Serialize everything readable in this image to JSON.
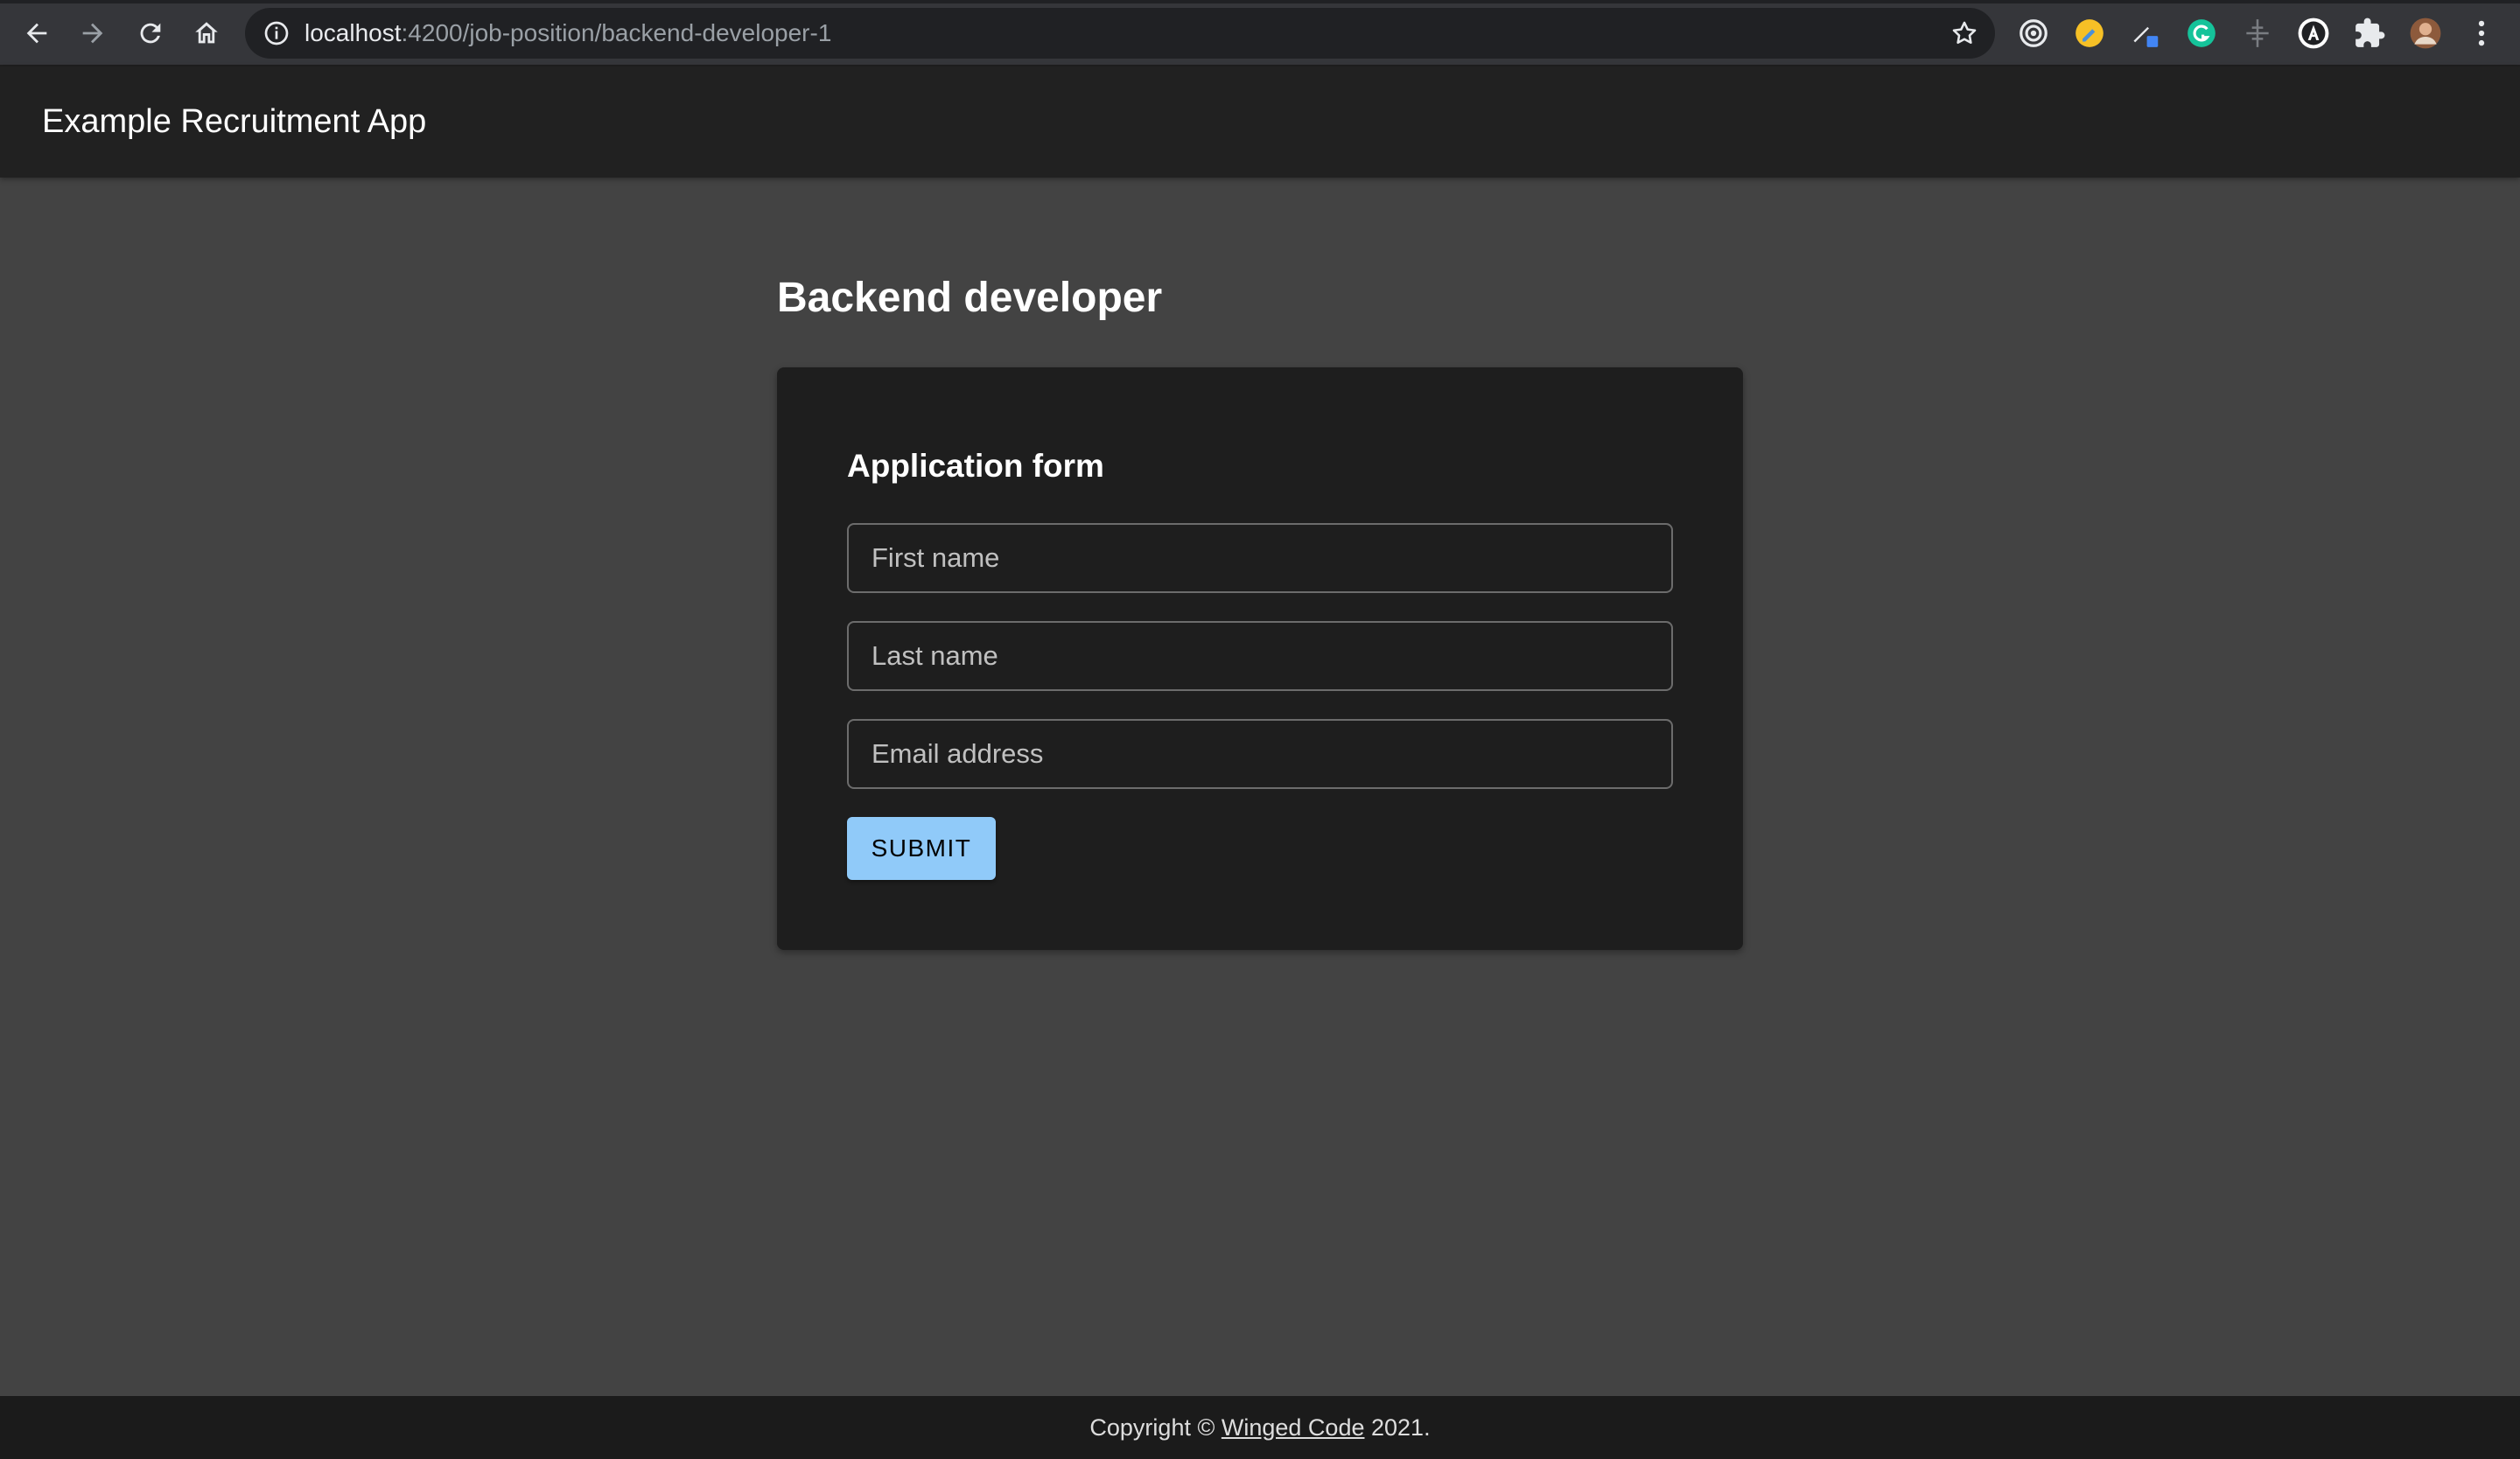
{
  "browser": {
    "url_host": "localhost",
    "url_path": ":4200/job-position/backend-developer-1"
  },
  "app": {
    "title": "Example Recruitment App"
  },
  "page": {
    "title": "Backend developer"
  },
  "form": {
    "title": "Application form",
    "first_name_placeholder": "First name",
    "last_name_placeholder": "Last name",
    "email_placeholder": "Email address",
    "submit_label": "SUBMIT"
  },
  "footer": {
    "prefix": "Copyright ©",
    "link_text": "Winged Code",
    "suffix": "2021."
  },
  "colors": {
    "page_bg": "#434343",
    "header_bg": "#212121",
    "card_bg": "#1e1e1e",
    "button_bg": "#90caf9",
    "footer_bg": "#1b1b1b"
  }
}
